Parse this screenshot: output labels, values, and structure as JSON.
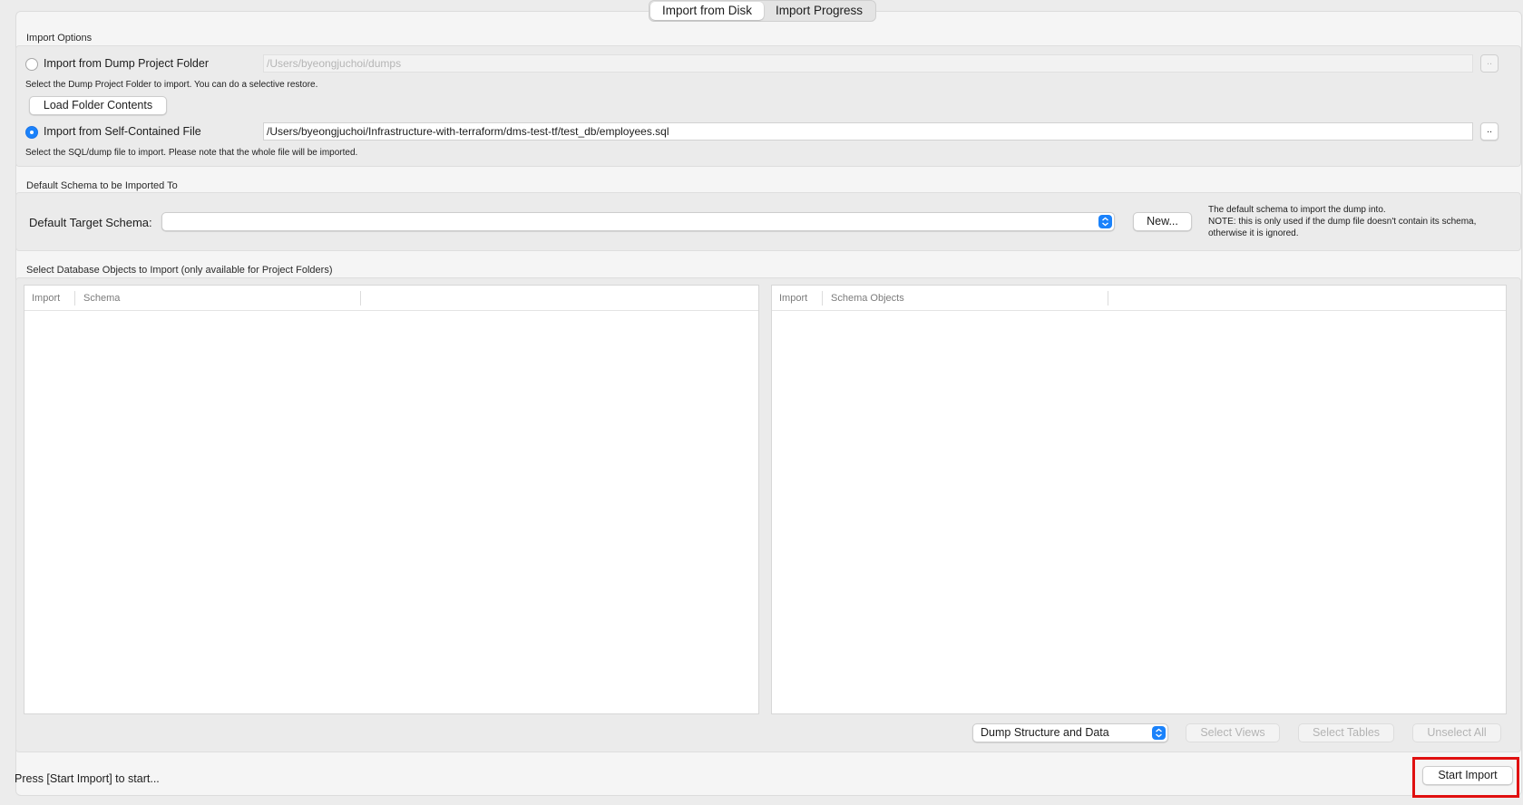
{
  "tabs": [
    "Import from Disk",
    "Import Progress"
  ],
  "import_options": {
    "title": "Import Options",
    "dump_folder_label": "Import from Dump Project Folder",
    "dump_folder_path": "/Users/byeongjuchoi/dumps",
    "dump_folder_hint": "Select the Dump Project Folder to import. You can do a selective restore.",
    "load_folder_button": "Load Folder Contents",
    "self_contained_label": "Import from Self-Contained File",
    "self_contained_path": "/Users/byeongjuchoi/Infrastructure-with-terraform/dms-test-tf/test_db/employees.sql",
    "self_contained_hint": "Select the SQL/dump file to import. Please note that the whole file will be imported.",
    "browse_label": "..",
    "selected_option": "self_contained"
  },
  "default_schema": {
    "title": "Default Schema to be Imported To",
    "label": "Default Target Schema:",
    "value": "",
    "new_button": "New...",
    "note_line1": "The default schema to import the dump into.",
    "note_line2": "NOTE: this is only used if the dump file doesn't contain its schema,",
    "note_line3": "otherwise it is ignored."
  },
  "db_objects": {
    "title": "Select Database Objects to Import (only available for Project Folders)",
    "left_table": {
      "columns": [
        "Import",
        "Schema"
      ]
    },
    "right_table": {
      "columns": [
        "Import",
        "Schema Objects"
      ]
    },
    "dump_mode": "Dump Structure and Data",
    "select_views_button": "Select Views",
    "select_tables_button": "Select Tables",
    "unselect_all_button": "Unselect All"
  },
  "footer": {
    "status": "Press [Start Import] to start...",
    "start_import_button": "Start Import"
  },
  "colors": {
    "accent": "#1a82fb",
    "highlight": "#e01010"
  }
}
